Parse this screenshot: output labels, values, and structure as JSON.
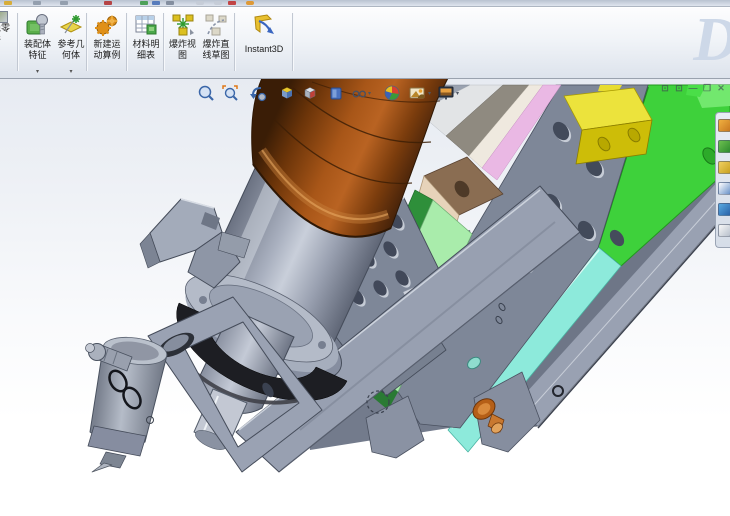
{
  "window": {
    "watermark": "D",
    "controls": {
      "pane_left": "⊡",
      "pane_right": "⊡",
      "minimize": "—",
      "restore": "❐",
      "close": "✕"
    }
  },
  "clipped_top_strip": {
    "fragment_colors": [
      "#d8a828",
      "#8e99a8",
      "#8e99a8",
      "#b23434",
      "#3f9a4a",
      "#4a72b8",
      "#7c8698",
      "#c4cbd6",
      "#c4cbd6",
      "#c03434",
      "#e09224"
    ]
  },
  "command_manager": {
    "dropdown_glyph": "▾",
    "partial_button": {
      "label": "隐零件"
    },
    "buttons": [
      {
        "line1": "装配体",
        "line2": "特征",
        "icon": "assembly-features",
        "has_dropdown": true
      },
      {
        "line1": "参考几",
        "line2": "何体",
        "icon": "reference-geometry",
        "has_dropdown": true
      },
      {
        "line1": "新建运",
        "line2": "动算例",
        "icon": "new-motion-study",
        "has_dropdown": false
      },
      {
        "line1": "材料明",
        "line2": "细表",
        "icon": "bill-of-materials",
        "has_dropdown": false
      },
      {
        "line1": "爆炸视",
        "line2": "图",
        "icon": "exploded-view",
        "has_dropdown": false
      },
      {
        "line1": "爆炸直",
        "line2": "线草图",
        "icon": "explode-line-sketch",
        "has_dropdown": false
      },
      {
        "line1": "Instant3D",
        "line2": "",
        "icon": "instant3d",
        "has_dropdown": false
      }
    ]
  },
  "viewport": {
    "caret_glyph": "▾",
    "heads_up_toolbar": [
      "zoom-to-fit",
      "zoom-to-area",
      "previous-view",
      "section-view",
      "view-orientation",
      "display-style",
      "hide-show-items",
      "edit-appearance",
      "apply-scene",
      "view-settings"
    ],
    "task_pane_tabs": [
      "solidworks-resources",
      "design-library",
      "file-explorer",
      "view-palette",
      "appearances-scenes",
      "custom-properties"
    ]
  },
  "model": {
    "description_colors": {
      "copper_motor": "#a85618",
      "steel_gray": "#a9b0bf",
      "black_collar": "#1d1e23",
      "bright_green_rail": "#3ed13b",
      "mint_plate": "#a9ecab",
      "dark_green_strip": "#2e8f3a",
      "cyan_rail": "#8deadb",
      "pink_strip": "#eab8e4",
      "yellow_block": "#ece33c",
      "tan_block_top": "#8a6d52",
      "tan_block_front": "#e7d3ba",
      "copper_plug": "#c87830"
    }
  }
}
